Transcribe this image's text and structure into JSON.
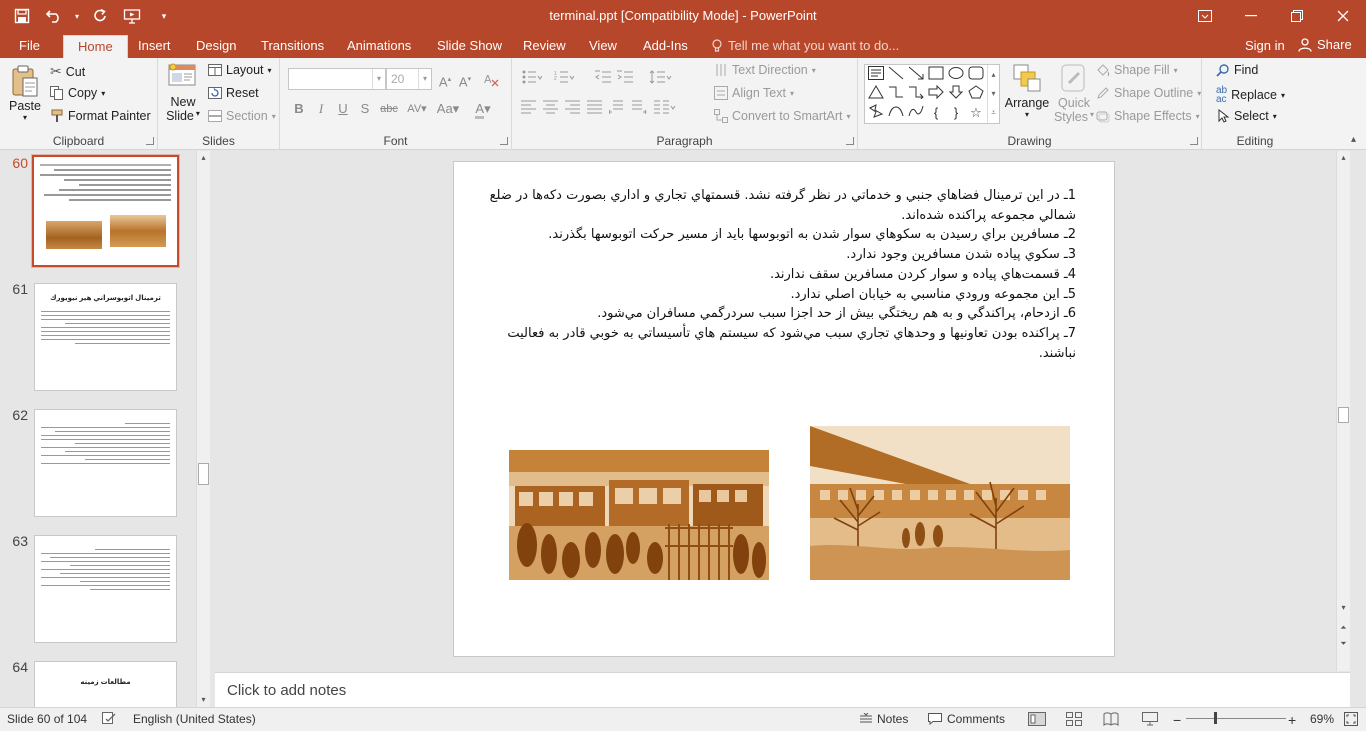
{
  "window": {
    "title": "terminal.ppt [Compatibility Mode] - PowerPoint"
  },
  "tabs": [
    "File",
    "Home",
    "Insert",
    "Design",
    "Transitions",
    "Animations",
    "Slide Show",
    "Review",
    "View",
    "Add-Ins"
  ],
  "tell_me": "Tell me what you want to do...",
  "account": {
    "sign_in": "Sign in",
    "share": "Share"
  },
  "ribbon": {
    "clipboard": {
      "label": "Clipboard",
      "paste": "Paste",
      "cut": "Cut",
      "copy": "Copy",
      "format_painter": "Format Painter"
    },
    "slides": {
      "label": "Slides",
      "new_slide_1": "New",
      "new_slide_2": "Slide",
      "layout": "Layout",
      "reset": "Reset",
      "section": "Section"
    },
    "font": {
      "label": "Font",
      "font_name": "",
      "font_size": "20"
    },
    "paragraph": {
      "label": "Paragraph",
      "text_direction": "Text Direction",
      "align_text": "Align Text",
      "convert_smartart": "Convert to SmartArt"
    },
    "drawing": {
      "label": "Drawing",
      "arrange": "Arrange",
      "quick_styles_1": "Quick",
      "quick_styles_2": "Styles",
      "shape_fill": "Shape Fill",
      "shape_outline": "Shape Outline",
      "shape_effects": "Shape Effects"
    },
    "editing": {
      "label": "Editing",
      "find": "Find",
      "replace": "Replace",
      "select": "Select"
    }
  },
  "thumbnails": [
    {
      "number": "60",
      "selected": true
    },
    {
      "number": "61",
      "title": "ترمينال اتوبوسراني هير نيويورك"
    },
    {
      "number": "62"
    },
    {
      "number": "63"
    },
    {
      "number": "64",
      "title": "مطالعات زمينه"
    }
  ],
  "slide": {
    "lines": [
      "1ـ در اين ترمينال فضاهاي جنبي و خدماتي در نظر گرفته نشد. قسمتهاي تجاري و اداري بصورت دكه‌ها در ضلع شمالي مجموعه پراكنده شده‌اند.",
      "2ـ مسافرين براي رسيدن به سكوهاي سوار شدن به اتوبوسها بايد از مسير حركت اتوبوسها بگذرند.",
      "3ـ سكوي پياده شدن مسافرين وجود ندارد.",
      "4ـ قسمت‌هاي پياده و سوار كردن مسافرين سقف ندارند.",
      "5ـ اين مجموعه ورودي مناسبي به خيابان اصلي ندارد.",
      "6ـ ازدحام، پراكندگي و به هم ريختگي بيش از حد اجزا سبب سردرگمي مسافران مي‌شود.",
      "7ـ پراكنده بودن تعاونيها و وحدهاي تجاري سبب مي‌شود كه سيستم هاي تأسيساتي به خوبي قادر به فعاليت نباشند."
    ]
  },
  "notes_placeholder": "Click to add notes",
  "statusbar": {
    "slide_info": "Slide 60 of 104",
    "language": "English (United States)",
    "notes": "Notes",
    "comments": "Comments",
    "zoom": "69%"
  },
  "colors": {
    "accent": "#b7472a",
    "ribbon_bg": "#f3f3f3",
    "workspace": "#e6e6e6",
    "sepia": "#b8742a"
  }
}
